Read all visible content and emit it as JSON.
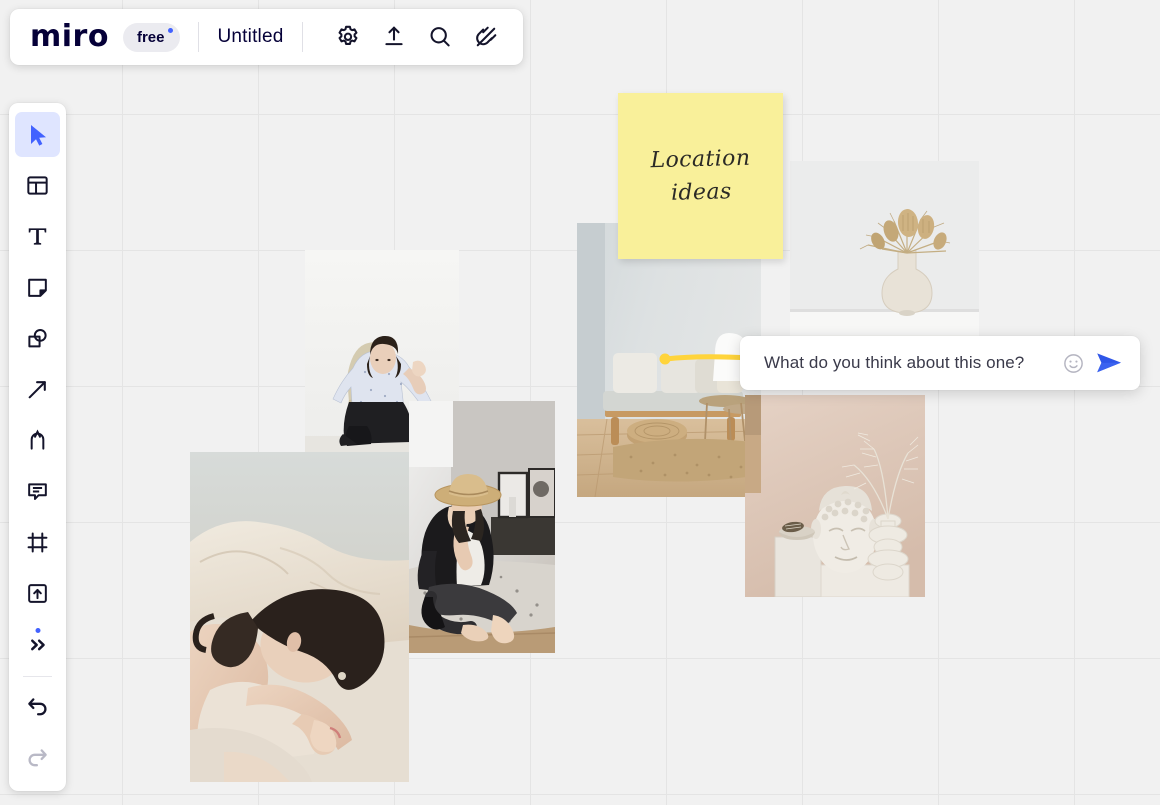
{
  "app": {
    "name": "Miro",
    "logo_text": "miro",
    "plan_badge": "free",
    "board_title": "Untitled",
    "accent_color": "#4262ff",
    "canvas_color": "#f1f1f1",
    "grid_color": "#e4e4e4"
  },
  "topbar": {
    "icons": [
      {
        "name": "settings-gear-icon",
        "label": "Settings"
      },
      {
        "name": "share-upload-icon",
        "label": "Share"
      },
      {
        "name": "search-icon",
        "label": "Search"
      },
      {
        "name": "apps-plugin-icon",
        "label": "Apps"
      }
    ]
  },
  "toolbar": {
    "items": [
      {
        "name": "select-cursor-tool",
        "label": "Select",
        "active": true
      },
      {
        "name": "templates-tool",
        "label": "Templates",
        "active": false
      },
      {
        "name": "text-tool",
        "label": "Text",
        "active": false
      },
      {
        "name": "sticky-note-tool",
        "label": "Sticky note",
        "active": false
      },
      {
        "name": "shapes-tool",
        "label": "Shapes",
        "active": false
      },
      {
        "name": "arrow-connector-tool",
        "label": "Connection line",
        "active": false
      },
      {
        "name": "pen-draw-tool",
        "label": "Pen",
        "active": false
      },
      {
        "name": "comment-tool",
        "label": "Comment",
        "active": false
      },
      {
        "name": "frame-tool",
        "label": "Frame",
        "active": false
      },
      {
        "name": "upload-tool",
        "label": "Upload",
        "active": false
      },
      {
        "name": "more-tools-tool",
        "label": "More tools",
        "active": false,
        "has_badge": true
      }
    ],
    "history": [
      {
        "name": "undo-button",
        "label": "Undo",
        "enabled": true
      },
      {
        "name": "redo-button",
        "label": "Redo",
        "enabled": false
      }
    ]
  },
  "board": {
    "sticky_note": {
      "text": "Location\nideas",
      "color": "#f9f09a"
    },
    "pen_annotation": {
      "color": "#ffd43b",
      "shape": "horizontal-stroke"
    },
    "images": [
      {
        "name": "photo-woman-chair",
        "alt": "Woman seated in chair against white wall"
      },
      {
        "name": "photo-woman-bed",
        "alt": "Woman resting head on knees on bed with cream linens"
      },
      {
        "name": "photo-woman-hat",
        "alt": "Woman in straw hat and leather jacket sitting on rug"
      },
      {
        "name": "photo-interior",
        "alt": "Minimal living room with wooden daybed and jute rug"
      },
      {
        "name": "photo-vase",
        "alt": "Dried banksia flowers in cream ceramic vase"
      },
      {
        "name": "photo-buddha",
        "alt": "Buddha head sculpture and ribbed vase on white pedestal"
      }
    ]
  },
  "chat": {
    "message": "What do you think about this one?",
    "emoji_button": "emoji-icon",
    "send_button": "send-icon",
    "send_color": "#2f56e8"
  }
}
